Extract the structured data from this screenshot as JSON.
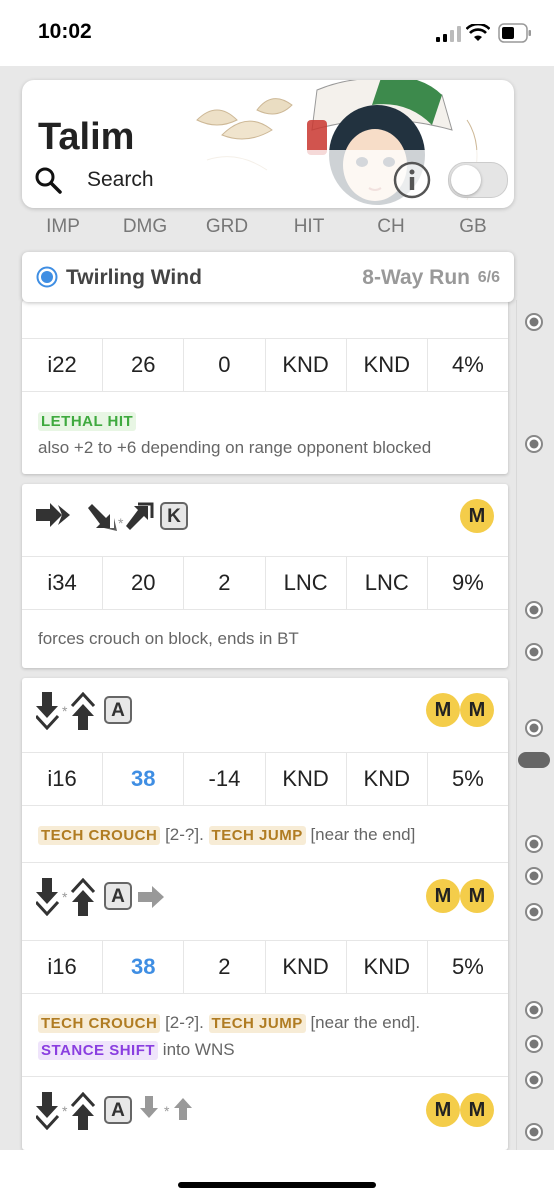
{
  "status_bar": {
    "time": "10:02"
  },
  "header": {
    "character": "Talim",
    "search_label": "Search"
  },
  "columns": [
    "IMP",
    "DMG",
    "GRD",
    "HIT",
    "CH",
    "GB"
  ],
  "movelist": {
    "name": "Twirling Wind",
    "stance": "8-Way Run",
    "count": "6/6"
  },
  "moves": [
    {
      "stats": [
        "i22",
        "26",
        "0",
        "KND",
        "KND",
        "4%"
      ],
      "tag1": "LETHAL HIT",
      "note": "also +2 to +6 depending on range opponent blocked"
    },
    {
      "key": "K",
      "badges": [
        "M"
      ],
      "stats": [
        "i34",
        "20",
        "2",
        "LNC",
        "LNC",
        "9%"
      ],
      "note": "forces crouch on block, ends in BT"
    },
    {
      "key": "A",
      "badges": [
        "M",
        "M"
      ],
      "stats": [
        "i16",
        "38",
        "-14",
        "KND",
        "KND",
        "5%"
      ],
      "tag1": "TECH CROUCH",
      "text1": " [2-?]. ",
      "tag2": "TECH JUMP",
      "text2": " [near the end]"
    },
    {
      "key": "A",
      "badges": [
        "M",
        "M"
      ],
      "stats": [
        "i16",
        "38",
        "2",
        "KND",
        "KND",
        "5%"
      ],
      "tag1": "TECH CROUCH",
      "text1": " [2-?]. ",
      "tag2": "TECH JUMP",
      "text2": " [near the end].",
      "tag3": "STANCE SHIFT",
      "text3": " into WNS"
    },
    {
      "key": "A",
      "badges": [
        "M",
        "M"
      ]
    }
  ],
  "colors": {
    "accent_blue": "#3f8ee3",
    "badge_yellow": "#f4cd4a",
    "tag_green": "#3faa3f",
    "tag_tan": "#b07c22",
    "tag_purple": "#8a3ee0"
  }
}
